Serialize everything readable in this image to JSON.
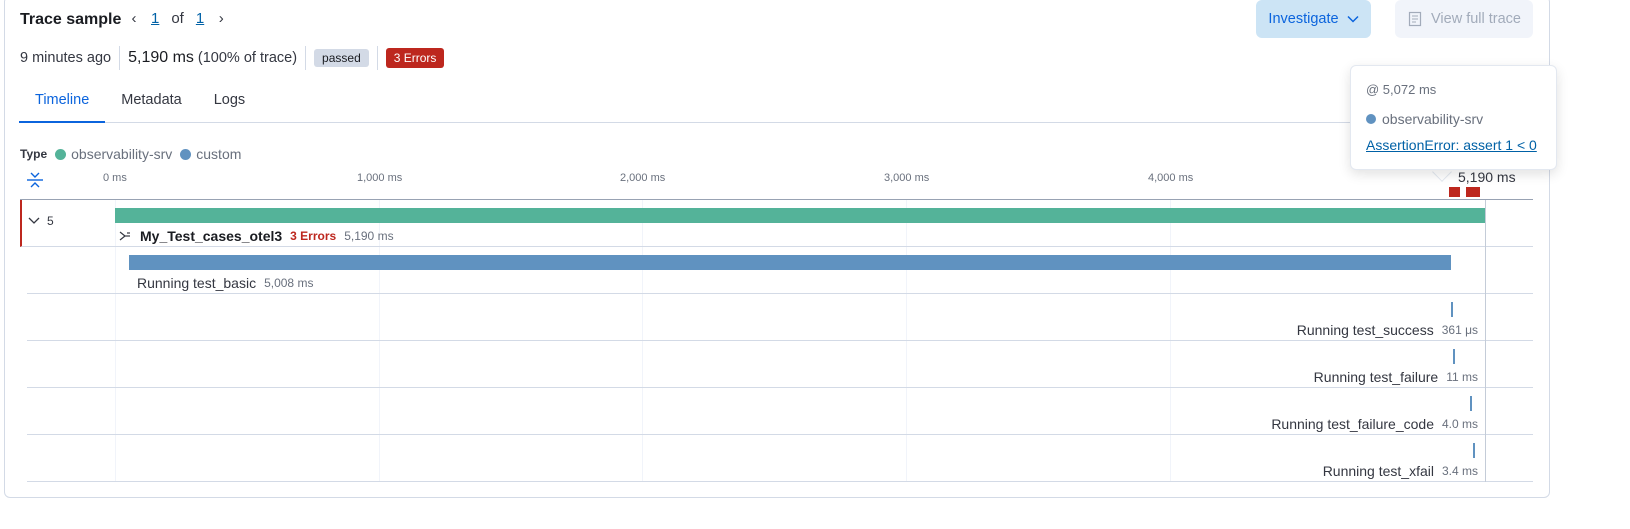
{
  "header": {
    "title": "Trace sample",
    "pager": {
      "current": "1",
      "of_label": "of",
      "total": "1"
    },
    "investigate_label": "Investigate",
    "view_full_trace_label": "View full trace"
  },
  "meta": {
    "time_ago": "9 minutes ago",
    "duration": "5,190 ms",
    "percent": "(100% of trace)",
    "status_badge": "passed",
    "errors_badge": "3 Errors"
  },
  "tabs": [
    {
      "label": "Timeline",
      "active": true
    },
    {
      "label": "Metadata",
      "active": false
    },
    {
      "label": "Logs",
      "active": false
    }
  ],
  "legend": {
    "label": "Type",
    "items": [
      {
        "label": "observability-srv",
        "color": "#54b399"
      },
      {
        "label": "custom",
        "color": "#6092c0"
      }
    ]
  },
  "axis": {
    "ticks": [
      "0 ms",
      "1,000 ms",
      "2,000 ms",
      "3,000 ms",
      "4,000 ms"
    ],
    "end_label": "5,190 ms"
  },
  "tooltip": {
    "at": "@ 5,072 ms",
    "service": "observability-srv",
    "service_color": "#6092c0",
    "error": "AssertionError: assert 1 < 0"
  },
  "spans": [
    {
      "name": "My_Test_cases_otel3",
      "errors": "3 Errors",
      "duration": "5,190 ms",
      "children_count": "5",
      "color": "#54b399"
    },
    {
      "name": "Running test_basic",
      "duration": "5,008 ms",
      "color": "#6092c0"
    },
    {
      "name": "Running test_success",
      "duration": "361 μs",
      "color": "#6092c0"
    },
    {
      "name": "Running test_failure",
      "duration": "11 ms",
      "color": "#6092c0"
    },
    {
      "name": "Running test_failure_code",
      "duration": "4.0 ms",
      "color": "#6092c0"
    },
    {
      "name": "Running test_xfail",
      "duration": "3.4 ms",
      "color": "#6092c0"
    }
  ]
}
